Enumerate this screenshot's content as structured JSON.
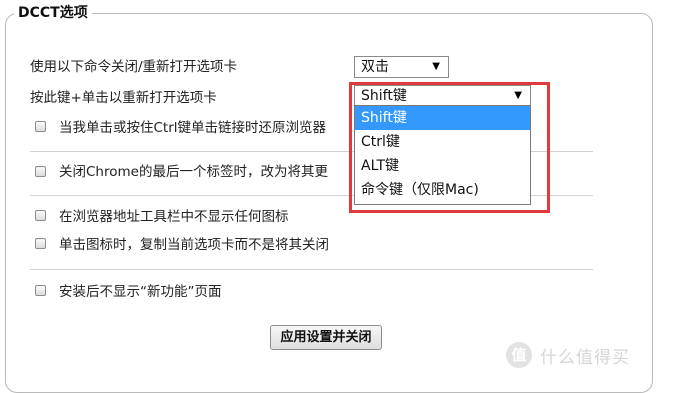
{
  "section": {
    "title": "DCCT选项"
  },
  "rows": {
    "close_command_label": "使用以下命令关闭/重新打开选项卡",
    "close_command_value": "双击",
    "modifier_label": "按此键+单击以重新打开选项卡",
    "modifier_value": "Shift键"
  },
  "dropdown": {
    "options": [
      "Shift键",
      "Ctrl键",
      "ALT键",
      "命令键（仅限Mac)"
    ],
    "selected": "Shift键"
  },
  "checkboxes": [
    {
      "label": "当我单击或按住Ctrl键单击链接时还原浏览器",
      "checked": false
    },
    {
      "label": "关闭Chrome的最后一个标签时，改为将其更",
      "checked": false
    },
    {
      "label": "在浏览器地址工具栏中不显示任何图标",
      "checked": false
    },
    {
      "label": "单击图标时，复制当前选项卡而不是将其关闭",
      "checked": false
    },
    {
      "label": "安装后不显示“新功能”页面",
      "checked": false
    }
  ],
  "button": {
    "label": "应用设置并关闭"
  },
  "watermark": {
    "logo": "值",
    "text": "什么值得买"
  },
  "colors": {
    "highlight_border": "#e23a3a",
    "selected_option": "#3399ff"
  }
}
